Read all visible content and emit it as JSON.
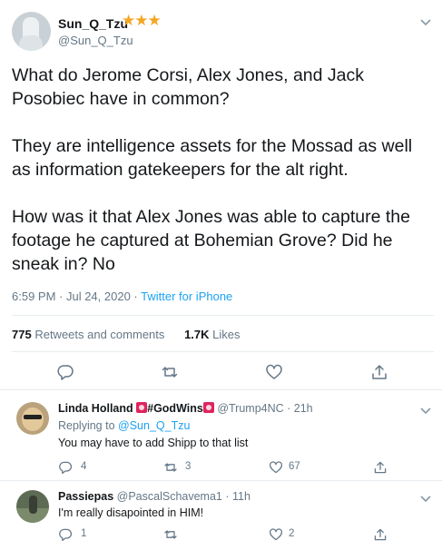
{
  "main_tweet": {
    "display_name": "Sun_Q_Tzu",
    "badge": "★★★",
    "handle": "@Sun_Q_Tzu",
    "text": "What do Jerome Corsi, Alex Jones, and Jack Posobiec have in common?\n\nThey are intelligence assets for the Mossad as well as information gatekeepers for the alt right.\n\nHow was it that Alex Jones was able to capture the footage he captured at Bohemian Grove? Did he sneak in? No",
    "timestamp": "6:59 PM · Jul 24, 2020 · ",
    "source": "Twitter for iPhone",
    "retweets_count": "775",
    "retweets_label": "Retweets and comments",
    "likes_count": "1.7K",
    "likes_label": "Likes"
  },
  "replies": [
    {
      "display_name": "Linda Holland",
      "name_tag": "#GodWins",
      "handle_time": "@Trump4NC · 21h",
      "replying_prefix": "Replying to ",
      "replying_handle": "@Sun_Q_Tzu",
      "text": "You may have to add Shipp to that list",
      "reply_count": "4",
      "retweet_count": "3",
      "like_count": "67"
    },
    {
      "display_name": "Passiepas",
      "handle_time": "@PascalSchavema1 · 11h",
      "text": "I'm really disapointed in HIM!",
      "reply_count": "1",
      "like_count": "2"
    }
  ],
  "icons": [
    "reply-icon",
    "retweet-icon",
    "like-icon",
    "share-icon",
    "chevron-down-icon"
  ],
  "colors": {
    "accent": "#1da1f2",
    "star": "#f5a623",
    "muted": "#657786",
    "text": "#14171a",
    "divider": "#e6ecf0"
  }
}
